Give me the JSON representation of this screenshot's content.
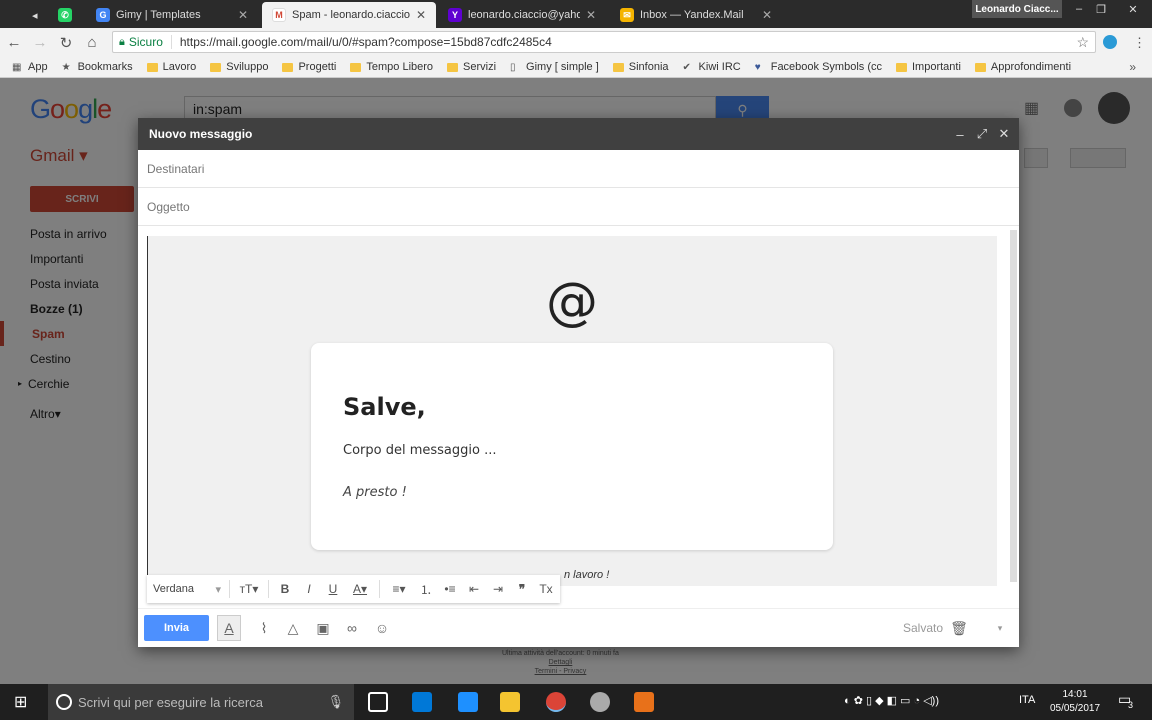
{
  "browser": {
    "tabs": [
      {
        "title": "Gimy | Templates",
        "active": false
      },
      {
        "title": "Spam - leonardo.ciaccio",
        "active": true
      },
      {
        "title": "leonardo.ciaccio@yahoo",
        "active": false
      },
      {
        "title": "Inbox — Yandex.Mail",
        "active": false
      }
    ],
    "user": "Leonardo Ciacc...",
    "secure_label": "Sicuro",
    "url": "https://mail.google.com/mail/u/0/#spam?compose=15bd87cdfc2485c4"
  },
  "bookmarks": [
    "App",
    "Bookmarks",
    "Lavoro",
    "Sviluppo",
    "Progetti",
    "Tempo Libero",
    "Servizi",
    "Gimy [ simple ]",
    "Sinfonia",
    "Kiwi IRC",
    "Facebook Symbols (cc",
    "Importanti",
    "Approfondimenti"
  ],
  "gmail": {
    "logo": "Google",
    "search_value": "in:spam",
    "label": "Gmail",
    "compose_label": "SCRIVI",
    "folders": [
      {
        "label": "Posta in arrivo"
      },
      {
        "label": "Importanti"
      },
      {
        "label": "Posta inviata"
      },
      {
        "label": "Bozze (1)"
      },
      {
        "label": "Spam"
      },
      {
        "label": "Cestino"
      },
      {
        "label": "Cerchie"
      },
      {
        "label": "Altro"
      }
    ],
    "footer": [
      "Ultima attività dell'account: 0 minuti fa",
      "Dettagli",
      "Termini - Privacy"
    ]
  },
  "compose": {
    "header": "Nuovo messaggio",
    "to_placeholder": "Destinatari",
    "subject_placeholder": "Oggetto",
    "body_symbol": "@",
    "greeting": "Salve,",
    "body_text": "Corpo del messaggio ...",
    "closing": "A presto !",
    "under_text": "n lavoro !",
    "font_name": "Verdana",
    "send_label": "Invia",
    "saved_label": "Salvato"
  },
  "taskbar": {
    "search_placeholder": "Scrivi qui per eseguire la ricerca",
    "language": "ITA",
    "time": "14:01",
    "date": "05/05/2017",
    "notifications": "3"
  }
}
